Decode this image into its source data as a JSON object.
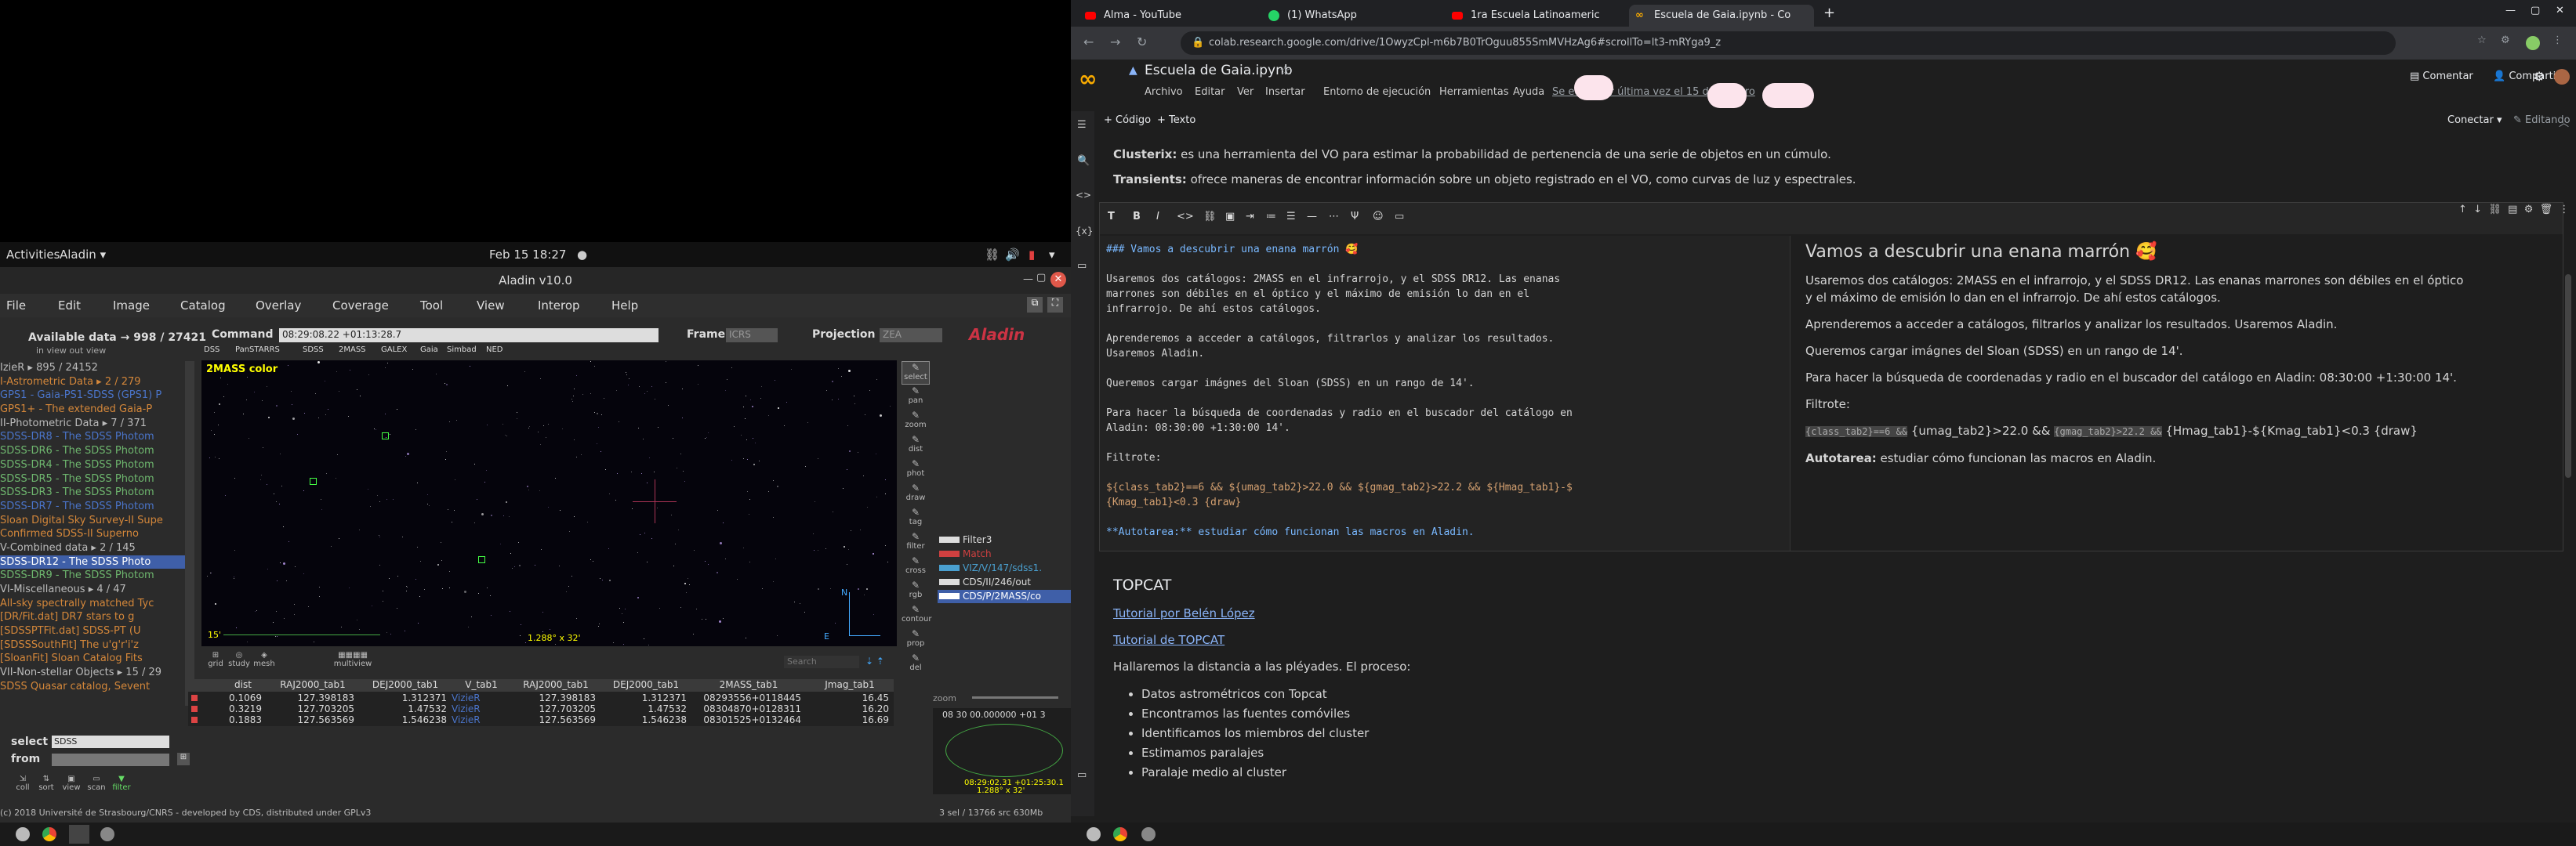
{
  "gnome": {
    "activities": "Activities",
    "app_menu": "Aladin",
    "clock": "Feb 15  18:27"
  },
  "aladin": {
    "title": "Aladin v10.0",
    "menu": [
      "File",
      "Edit",
      "Image",
      "Catalog",
      "Overlay",
      "Coverage",
      "Tool",
      "View",
      "Interop",
      "Help"
    ],
    "available_label": "Available data → 998 / 27421",
    "available_sub": "in view  out view",
    "command_label": "Command",
    "command_value": "08:29:08.22 +01:13:28.7",
    "frame_label": "Frame",
    "frame_value": "ICRS",
    "projection_label": "Projection",
    "projection_value": "ZEA",
    "shortcuts": [
      "DSS",
      "PanSTARRS",
      "SDSS",
      "2MASS",
      "GALEX",
      "Gaia",
      "Simbad",
      "NED"
    ],
    "tree": [
      {
        "text": "IzieR  ▸  895 / 24152",
        "cls": "gray"
      },
      {
        "text": "I-Astrometric Data  ▸  2 / 279",
        "cls": "orange"
      },
      {
        "text": " GPS1 - Gaia-PS1-SDSS (GPS1) P",
        "cls": "blue"
      },
      {
        "text": " GPS1+ - The extended Gaia-P",
        "cls": "orange"
      },
      {
        "text": "II-Photometric Data  ▸  7 / 371",
        "cls": "gray"
      },
      {
        "text": " SDSS-DR8 - The SDSS Photom",
        "cls": "blue"
      },
      {
        "text": " SDSS-DR6 - The SDSS Photom",
        "cls": "green"
      },
      {
        "text": " SDSS-DR4 - The SDSS Photom",
        "cls": "green"
      },
      {
        "text": " SDSS-DR5 - The SDSS Photom",
        "cls": "green"
      },
      {
        "text": " SDSS-DR3 - The SDSS Photom",
        "cls": "green"
      },
      {
        "text": " SDSS-DR7 - The SDSS Photom",
        "cls": "blue"
      },
      {
        "text": " Sloan Digital Sky Survey-II Supe",
        "cls": "orange"
      },
      {
        "text": "   Confirmed SDSS-II Superno",
        "cls": "orange"
      },
      {
        "text": "V-Combined data  ▸  2 / 145",
        "cls": "gray"
      },
      {
        "text": " SDSS-DR12 - The SDSS Photo",
        "cls": "blue"
      },
      {
        "text": " SDSS-DR9 - The SDSS Photom",
        "cls": "green"
      },
      {
        "text": "VI-Miscellaneous  ▸  4 / 47",
        "cls": "gray"
      },
      {
        "text": " All-sky spectrally matched Tyc",
        "cls": "orange"
      },
      {
        "text": "  [DR/Fit.dat] DR7 stars to g",
        "cls": "orange"
      },
      {
        "text": "  [SDSSPTFit.dat] SDSS-PT (U",
        "cls": "orange"
      },
      {
        "text": "  [SDSSSouthFit] The u'g'r'i'z",
        "cls": "orange"
      },
      {
        "text": "  [SloanFit] Sloan Catalog Fits",
        "cls": "orange"
      },
      {
        "text": "VII-Non-stellar Objects  ▸  15 / 29",
        "cls": "gray"
      },
      {
        "text": " SDSS Quasar catalog, Sevent",
        "cls": "orange"
      }
    ],
    "select_label": "select",
    "select_value": "SDSS",
    "from_label": "from",
    "bottom_tools": [
      "coll",
      "sort",
      "view",
      "scan",
      "filter"
    ],
    "sky_label": "2MASS color",
    "sky_scale": "15'",
    "sky_fov": "1.288° x 32'",
    "layers": [
      {
        "name": "Filter3",
        "color": "#ddd"
      },
      {
        "name": "Match",
        "color": "#d04040"
      },
      {
        "name": "VIZ/V/147/sdss1.",
        "color": "#4aa0d0"
      },
      {
        "name": "CDS/II/246/out",
        "color": "#ddd"
      },
      {
        "name": "CDS/P/2MASS/co",
        "color": "#fff"
      }
    ],
    "right_tools": [
      "select",
      "pan",
      "zoom",
      "dist",
      "phot",
      "draw",
      "tag",
      "filter",
      "cross",
      "rgb",
      "contour",
      "prop",
      "del"
    ],
    "view_tools": [
      "grid",
      "study",
      "mesh",
      "multiview"
    ],
    "search_placeholder": "Search",
    "table_headers": [
      "",
      "dist",
      "RAJ2000_tab1",
      "DEJ2000_tab1",
      "V_tab1",
      "RAJ2000_tab1",
      "DEJ2000_tab1",
      "2MASS_tab1",
      "Jmag_tab1"
    ],
    "table_rows": [
      [
        "",
        "0.1069",
        "127.398183",
        "1.312371",
        "VizieR",
        "127.398183",
        "1.312371",
        "08293556+0118445",
        "16.45"
      ],
      [
        "",
        "0.3219",
        "127.703205",
        "1.47532",
        "VizieR",
        "127.703205",
        "1.47532",
        "08304870+0128311",
        "16.20"
      ],
      [
        "",
        "0.1883",
        "127.563569",
        "1.546238",
        "VizieR",
        "127.563569",
        "1.546238",
        "08301525+0132464",
        "16.69"
      ]
    ],
    "zoom_label": "zoom",
    "coord_label": "08 30 00.000000 +01 3",
    "location_fov": "1.288° x 32'",
    "location_coords": "08:29:02.31 +01:25:30.1",
    "footer": "(c) 2018 Université de Strasbourg/CNRS - developed by CDS, distributed under GPLv3",
    "mem_status": "3 sel / 13766 src   630Mb"
  },
  "chrome": {
    "tabs": [
      "Alma - YouTube",
      "(1) WhatsApp",
      "1ra Escuela Latinoameric",
      "Escuela de Gaia.ipynb - Co"
    ],
    "url": "colab.research.google.com/drive/1OwyzCpl-m6b7B0TrOguu855SmMVHzAg6#scrollTo=lt3-mRYga9_z"
  },
  "colab": {
    "notebook_title": "Escuela de Gaia.ipynb",
    "menu": [
      "Archivo",
      "Editar",
      "Ver",
      "Insertar",
      "Entorno de ejecución",
      "Herramientas",
      "Ayuda"
    ],
    "last_edit": "Se editó por última vez el 15 de febrero",
    "comment": "Comentar",
    "share": "Compartir",
    "add_code": "+ Código",
    "add_text": "+ Texto",
    "connect": "Conectar",
    "editing": "Editando",
    "clusterix_bold": "Clusterix:",
    "clusterix_text": " es una herramienta del VO para estimar la probabilidad de pertenencia de una serie de objetos en un cúmulo.",
    "transients_bold": "Transients:",
    "transients_text": " ofrece maneras de encontrar información sobre un objeto registrado en el VO, como curvas de luz y espectrales.",
    "editor_lines": [
      "### Vamos a descubrir una enana marrón 🥰",
      "",
      "Usaremos dos catálogos: 2MASS en el infrarrojo, y el SDSS DR12. Las enanas",
      "marrones son débiles en el óptico y el máximo de emisión lo dan en el",
      "infrarrojo. De ahí estos catálogos.",
      "",
      "Aprenderemos a acceder a catálogos, filtrarlos y analizar los resultados.",
      "Usaremos Aladin.",
      "",
      "Queremos cargar imágnes del Sloan (SDSS) en un rango de 14'.",
      "",
      "Para hacer la búsqueda de coordenadas y radio en el buscador del catálogo en",
      "Aladin: 08:30:00 +1:30:00 14'.",
      "",
      "Filtrote:",
      "",
      "${class_tab2}==6 && ${umag_tab2}>22.0 && ${gmag_tab2}>22.2 && ${Hmag_tab1}-$",
      "{Kmag_tab1}<0.3 {draw}",
      "",
      "**Autotarea:** estudiar cómo funcionan las macros en Aladin."
    ],
    "preview_heading": "Vamos a descubrir una enana marrón 🥰",
    "preview_p1": "Usaremos dos catálogos: 2MASS en el infrarrojo, y el SDSS DR12. Las enanas marrones son débiles en el óptico y el máximo de emisión lo dan en el infrarrojo. De ahí estos catálogos.",
    "preview_p2": "Aprenderemos a acceder a catálogos, filtrarlos y analizar los resultados. Usaremos Aladin.",
    "preview_p3": "Queremos cargar imágnes del Sloan (SDSS) en un rango de 14'.",
    "preview_p4": "Para hacer la búsqueda de coordenadas y radio en el buscador del catálogo en Aladin: 08:30:00 +1:30:00 14'.",
    "preview_filtrote": "Filtrote:",
    "filter_pre1": "{class_tab2}==6 &&",
    "filter_mid1": " {umag_tab2}>22.0 && ",
    "filter_pre2": "{gmag_tab2}>22.2 &&",
    "filter_mid2": " {Hmag_tab1}-${Kmag_tab1}<0.3 {draw}",
    "autotarea_bold": "Autotarea:",
    "autotarea_text": " estudiar cómo funcionan las macros en Aladin.",
    "topcat_heading": "TOPCAT",
    "link1": "Tutorial por Belén López",
    "link2": "Tutorial de TOPCAT",
    "topcat_intro": "Hallaremos la distancia a las pléyades. El proceso:",
    "bullets": [
      "Datos astrométricos con Topcat",
      "Encontramos las fuentes comóviles",
      "Identificamos los miembros del cluster",
      "Estimamos paralajes",
      "Paralaje medio al cluster"
    ]
  },
  "colors": {
    "accent_orange": "#f9ab00",
    "link": "#8ab4f8",
    "aladin_bg": "#2b2b2b",
    "colab_bg": "#1e1e1e"
  }
}
